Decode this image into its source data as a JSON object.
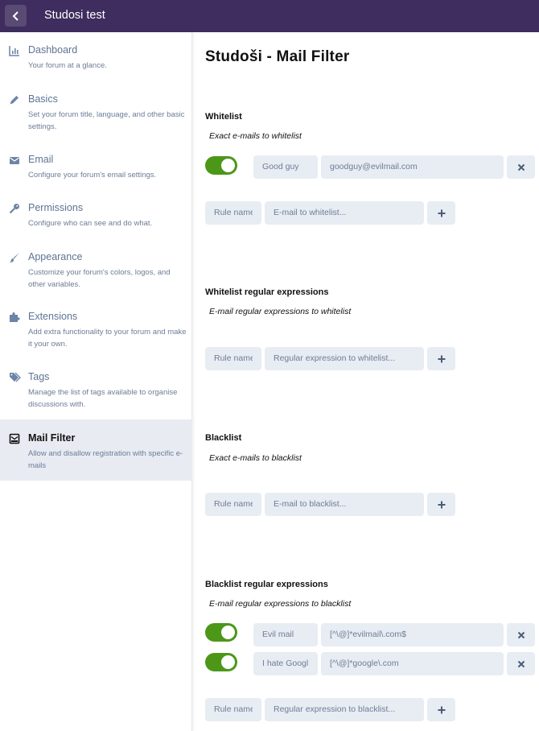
{
  "header": {
    "forum_title": "Studosi test",
    "back_icon": "chevron-left-icon"
  },
  "sidebar": {
    "items": [
      {
        "label": "Dashboard",
        "desc": "Your forum at a glance.",
        "icon": "chart-icon"
      },
      {
        "label": "Basics",
        "desc": "Set your forum title, language, and other basic settings.",
        "icon": "pencil-icon"
      },
      {
        "label": "Email",
        "desc": "Configure your forum's email settings.",
        "icon": "envelope-icon"
      },
      {
        "label": "Permissions",
        "desc": "Configure who can see and do what.",
        "icon": "key-icon"
      },
      {
        "label": "Appearance",
        "desc": "Customize your forum's colors, logos, and other variables.",
        "icon": "paintbrush-icon"
      },
      {
        "label": "Extensions",
        "desc": "Add extra functionality to your forum and make it your own.",
        "icon": "puzzle-icon"
      },
      {
        "label": "Tags",
        "desc": "Manage the list of tags available to organise discussions with.",
        "icon": "tags-icon"
      },
      {
        "label": "Mail Filter",
        "desc": "Allow and disallow registration with specific e-mails",
        "icon": "mail-filter-icon",
        "active": true
      }
    ]
  },
  "main": {
    "title": "Studoši - Mail Filter",
    "whitelist": {
      "title": "Whitelist",
      "desc": "Exact e-mails to whitelist",
      "rules": [
        {
          "name": "Good guy",
          "value": "goodguy@evilmail.com",
          "enabled": true
        }
      ],
      "new_name_placeholder": "Rule name",
      "new_value_placeholder": "E-mail to whitelist..."
    },
    "whitelist_regex": {
      "title": "Whitelist regular expressions",
      "desc": "E-mail regular expressions to whitelist",
      "new_name_placeholder": "Rule name",
      "new_value_placeholder": "Regular expression to whitelist..."
    },
    "blacklist": {
      "title": "Blacklist",
      "desc": "Exact e-mails to blacklist",
      "new_name_placeholder": "Rule name",
      "new_value_placeholder": "E-mail to blacklist..."
    },
    "blacklist_regex": {
      "title": "Blacklist regular expressions",
      "desc": "E-mail regular expressions to blacklist",
      "rules": [
        {
          "name": "Evil mail",
          "value": "[^\\@]*evilmail\\.com$",
          "enabled": true
        },
        {
          "name": "I hate Googl",
          "value": "[^\\@]*google\\.com",
          "enabled": true
        }
      ],
      "new_name_placeholder": "Rule name",
      "new_value_placeholder": "Regular expression to blacklist..."
    }
  },
  "colors": {
    "header_bg": "#3e2d5e",
    "toggle_on": "#4c9718",
    "field_bg": "#e8ecf3",
    "active_nav_bg": "#e8ebf2"
  }
}
